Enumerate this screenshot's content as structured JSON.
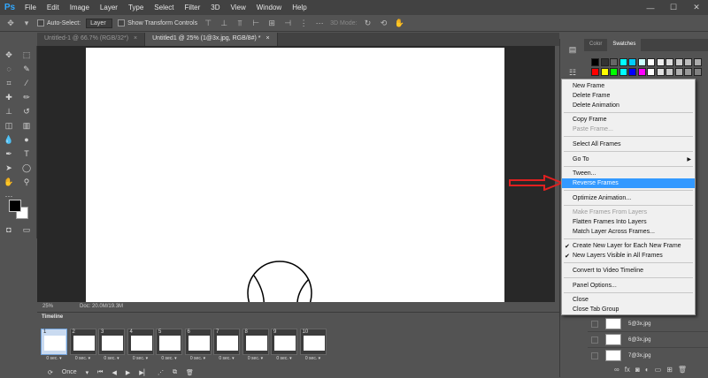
{
  "menubar": {
    "logo": "Ps",
    "items": [
      "File",
      "Edit",
      "Image",
      "Layer",
      "Type",
      "Select",
      "Filter",
      "3D",
      "View",
      "Window",
      "Help"
    ],
    "window_controls": [
      "—",
      "☐",
      "✕"
    ]
  },
  "options": {
    "auto_select_label": "Auto-Select:",
    "auto_select_value": "Layer",
    "transform_label": "Show Transform Controls",
    "mode_3d_label": "3D Mode:"
  },
  "tabs": [
    {
      "label": "Untitled-1 @ 66.7% (RGB/32*)",
      "close": "×"
    },
    {
      "label": "Untitled1 @ 25% (1@3x.jpg, RGB/8#) *",
      "close": "×"
    }
  ],
  "status": {
    "zoom": "25%",
    "doc": "Doc: 20.0M/19.3M"
  },
  "timeline": {
    "title": "Timeline",
    "frames": [
      {
        "num": "1",
        "delay": "0 sec."
      },
      {
        "num": "2",
        "delay": "0 sec."
      },
      {
        "num": "3",
        "delay": "0 sec."
      },
      {
        "num": "4",
        "delay": "0 sec."
      },
      {
        "num": "5",
        "delay": "0 sec."
      },
      {
        "num": "6",
        "delay": "0 sec."
      },
      {
        "num": "7",
        "delay": "0 sec."
      },
      {
        "num": "8",
        "delay": "0 sec."
      },
      {
        "num": "9",
        "delay": "0 sec."
      },
      {
        "num": "10",
        "delay": "0 sec."
      }
    ],
    "loop": "Once"
  },
  "swatches_panel": {
    "tabs": [
      "Color",
      "Swatches"
    ],
    "row1": [
      "#000000",
      "#333333",
      "#666666",
      "#00ffff",
      "#00ccff",
      "#ccffff",
      "#ffffff",
      "#eeeeee",
      "#dddddd",
      "#cccccc",
      "#bbbbbb",
      "#aaaaaa"
    ],
    "row2": [
      "#ff0000",
      "#ffff00",
      "#00ff00",
      "#00ffff",
      "#0000ff",
      "#ff00ff",
      "#ffffff",
      "#e0e0e0",
      "#c8c8c8",
      "#b0b0b0",
      "#989898",
      "#808080"
    ]
  },
  "layers": [
    {
      "name": "5@3x.jpg"
    },
    {
      "name": "6@3x.jpg"
    },
    {
      "name": "7@3x.jpg"
    }
  ],
  "context_menu": {
    "items": [
      {
        "label": "New Frame",
        "disabled": false
      },
      {
        "label": "Delete Frame",
        "disabled": false
      },
      {
        "label": "Delete Animation",
        "disabled": false
      },
      {
        "label": "Copy Frame",
        "disabled": false
      },
      {
        "label": "Paste Frame...",
        "disabled": true
      },
      {
        "label": "Select All Frames",
        "disabled": false
      },
      {
        "label": "Go To",
        "disabled": false
      },
      {
        "label": "Tween...",
        "disabled": false
      },
      {
        "label": "Reverse Frames",
        "disabled": false
      },
      {
        "label": "Optimize Animation...",
        "disabled": false
      },
      {
        "label": "Make Frames From Layers",
        "disabled": true
      },
      {
        "label": "Flatten Frames Into Layers",
        "disabled": false
      },
      {
        "label": "Match Layer Across Frames...",
        "disabled": false
      },
      {
        "label": "Create New Layer for Each New Frame",
        "disabled": false
      },
      {
        "label": "New Layers Visible in All Frames",
        "disabled": false
      },
      {
        "label": "Convert to Video Timeline",
        "disabled": false
      },
      {
        "label": "Panel Options...",
        "disabled": false
      },
      {
        "label": "Close",
        "disabled": false
      },
      {
        "label": "Close Tab Group",
        "disabled": false
      }
    ],
    "highlighted": "Reverse Frames",
    "checked": [
      "Create New Layer for Each New Frame",
      "New Layers Visible in All Frames"
    ],
    "submenu": [
      "Go To"
    ]
  },
  "colors": {
    "highlight": "#3399ff",
    "arrow": "#e02020",
    "ps_blue": "#31a8ff"
  }
}
